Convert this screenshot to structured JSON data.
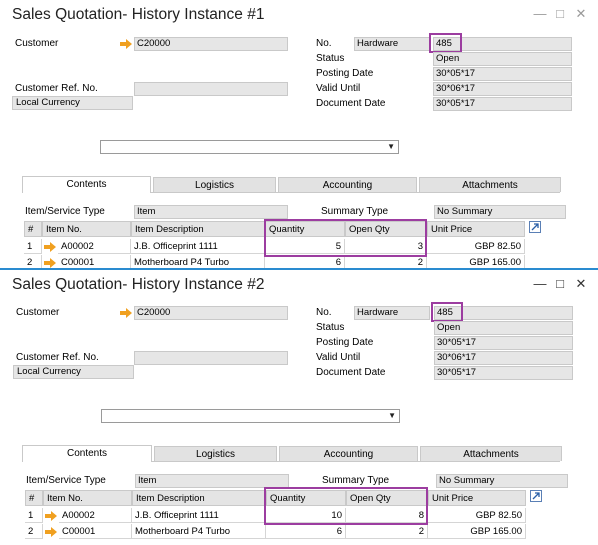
{
  "windows": [
    {
      "title": "Sales Quotation- History Instance #1",
      "customer_label": "Customer",
      "customer_value": "C20000",
      "customer_ref_label": "Customer Ref. No.",
      "currency": "Local Currency",
      "no_label": "No.",
      "series": "Hardware",
      "doc_no": "485",
      "status_label": "Status",
      "status": "Open",
      "posting_label": "Posting Date",
      "posting_date": "30*05*17",
      "valid_label": "Valid Until",
      "valid_until": "30*06*17",
      "doc_date_label": "Document Date",
      "doc_date": "30*05*17",
      "tabs": [
        "Contents",
        "Logistics",
        "Accounting",
        "Attachments"
      ],
      "item_type_label": "Item/Service Type",
      "item_type": "Item",
      "summary_label": "Summary Type",
      "summary": "No Summary",
      "columns": [
        "#",
        "Item No.",
        "Item Description",
        "Quantity",
        "Open Qty",
        "Unit Price"
      ],
      "rows": [
        {
          "n": "1",
          "item": "A00002",
          "desc": "J.B. Officeprint 1111",
          "qty": "5",
          "open": "3",
          "price": "GBP 82.50"
        },
        {
          "n": "2",
          "item": "C00001",
          "desc": "Motherboard P4 Turbo",
          "qty": "6",
          "open": "2",
          "price": "GBP 165.00"
        }
      ]
    },
    {
      "title": "Sales Quotation- History Instance #2",
      "customer_label": "Customer",
      "customer_value": "C20000",
      "customer_ref_label": "Customer Ref. No.",
      "currency": "Local Currency",
      "no_label": "No.",
      "series": "Hardware",
      "doc_no": "485",
      "status_label": "Status",
      "status": "Open",
      "posting_label": "Posting Date",
      "posting_date": "30*05*17",
      "valid_label": "Valid Until",
      "valid_until": "30*06*17",
      "doc_date_label": "Document Date",
      "doc_date": "30*05*17",
      "tabs": [
        "Contents",
        "Logistics",
        "Accounting",
        "Attachments"
      ],
      "item_type_label": "Item/Service Type",
      "item_type": "Item",
      "summary_label": "Summary Type",
      "summary": "No Summary",
      "columns": [
        "#",
        "Item No.",
        "Item Description",
        "Quantity",
        "Open Qty",
        "Unit Price"
      ],
      "rows": [
        {
          "n": "1",
          "item": "A00002",
          "desc": "J.B. Officeprint 1111",
          "qty": "10",
          "open": "8",
          "price": "GBP 82.50"
        },
        {
          "n": "2",
          "item": "C00001",
          "desc": "Motherboard P4 Turbo",
          "qty": "6",
          "open": "2",
          "price": "GBP 165.00"
        }
      ]
    }
  ],
  "icons": {
    "link_arrow": "orange-link-arrow-icon",
    "expand": "expand-icon",
    "minimize": "minimize-icon",
    "maximize": "maximize-icon",
    "close": "close-icon"
  },
  "colors": {
    "highlight": "#9c3da0",
    "separator": "#2a8bd0",
    "link_arrow": "#f0a020"
  }
}
